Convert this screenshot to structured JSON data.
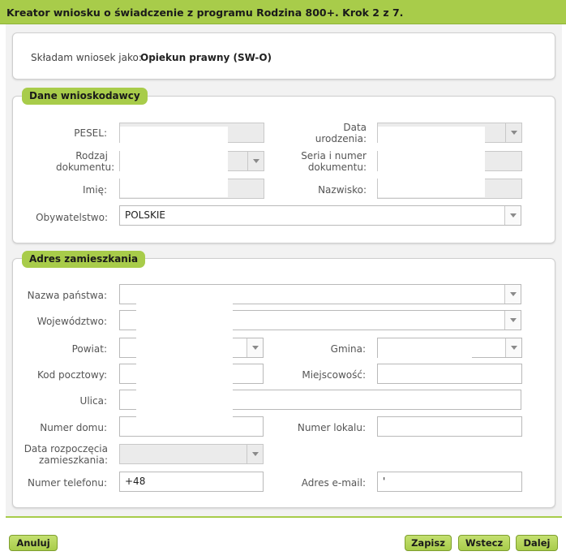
{
  "header": {
    "title": "Kreator wniosku o świadczenie z programu Rodzina 800+. Krok 2 z 7."
  },
  "role": {
    "label": "Składam wniosek jako:",
    "value": "Opiekun prawny (SW-O)"
  },
  "applicant": {
    "legend": "Dane wnioskodawcy",
    "pesel_label": "PESEL:",
    "birth_date_label": "Data urodzenia:",
    "doc_type_label": "Rodzaj dokumentu:",
    "doc_number_label": "Seria i numer dokumentu:",
    "first_name_label": "Imię:",
    "last_name_label": "Nazwisko:",
    "citizenship_label": "Obywatelstwo:",
    "citizenship_value": "POLSKIE"
  },
  "address": {
    "legend": "Adres zamieszkania",
    "country_label": "Nazwa państwa:",
    "voivodeship_label": "Województwo:",
    "county_label": "Powiat:",
    "commune_label": "Gmina:",
    "postal_label": "Kod pocztowy:",
    "city_label": "Miejscowość:",
    "street_label": "Ulica:",
    "house_label": "Numer domu:",
    "flat_label": "Numer lokalu:",
    "residence_start_label": "Data rozpoczęcia zamieszkania:",
    "phone_label": "Numer telefonu:",
    "phone_value": "+48",
    "email_label": "Adres e-mail:",
    "email_value": "'"
  },
  "footer": {
    "cancel": "Anuluj",
    "save": "Zapisz",
    "back": "Wstecz",
    "next": "Dalej"
  },
  "colors": {
    "accent": "#a8cc4a",
    "panel_bg": "#f2f2f2"
  }
}
